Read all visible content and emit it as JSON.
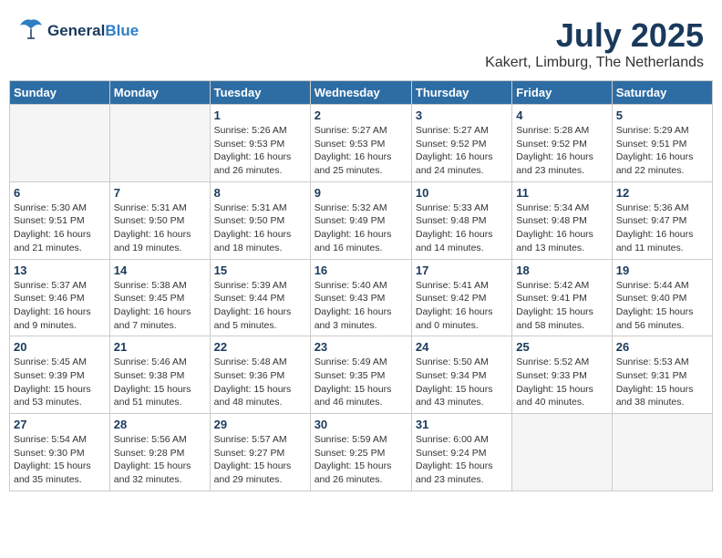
{
  "header": {
    "logo_general": "General",
    "logo_blue": "Blue",
    "month_title": "July 2025",
    "location": "Kakert, Limburg, The Netherlands"
  },
  "weekdays": [
    "Sunday",
    "Monday",
    "Tuesday",
    "Wednesday",
    "Thursday",
    "Friday",
    "Saturday"
  ],
  "weeks": [
    [
      {
        "day": "",
        "sunrise": "",
        "sunset": "",
        "daylight": ""
      },
      {
        "day": "",
        "sunrise": "",
        "sunset": "",
        "daylight": ""
      },
      {
        "day": "1",
        "sunrise": "Sunrise: 5:26 AM",
        "sunset": "Sunset: 9:53 PM",
        "daylight": "Daylight: 16 hours and 26 minutes."
      },
      {
        "day": "2",
        "sunrise": "Sunrise: 5:27 AM",
        "sunset": "Sunset: 9:53 PM",
        "daylight": "Daylight: 16 hours and 25 minutes."
      },
      {
        "day": "3",
        "sunrise": "Sunrise: 5:27 AM",
        "sunset": "Sunset: 9:52 PM",
        "daylight": "Daylight: 16 hours and 24 minutes."
      },
      {
        "day": "4",
        "sunrise": "Sunrise: 5:28 AM",
        "sunset": "Sunset: 9:52 PM",
        "daylight": "Daylight: 16 hours and 23 minutes."
      },
      {
        "day": "5",
        "sunrise": "Sunrise: 5:29 AM",
        "sunset": "Sunset: 9:51 PM",
        "daylight": "Daylight: 16 hours and 22 minutes."
      }
    ],
    [
      {
        "day": "6",
        "sunrise": "Sunrise: 5:30 AM",
        "sunset": "Sunset: 9:51 PM",
        "daylight": "Daylight: 16 hours and 21 minutes."
      },
      {
        "day": "7",
        "sunrise": "Sunrise: 5:31 AM",
        "sunset": "Sunset: 9:50 PM",
        "daylight": "Daylight: 16 hours and 19 minutes."
      },
      {
        "day": "8",
        "sunrise": "Sunrise: 5:31 AM",
        "sunset": "Sunset: 9:50 PM",
        "daylight": "Daylight: 16 hours and 18 minutes."
      },
      {
        "day": "9",
        "sunrise": "Sunrise: 5:32 AM",
        "sunset": "Sunset: 9:49 PM",
        "daylight": "Daylight: 16 hours and 16 minutes."
      },
      {
        "day": "10",
        "sunrise": "Sunrise: 5:33 AM",
        "sunset": "Sunset: 9:48 PM",
        "daylight": "Daylight: 16 hours and 14 minutes."
      },
      {
        "day": "11",
        "sunrise": "Sunrise: 5:34 AM",
        "sunset": "Sunset: 9:48 PM",
        "daylight": "Daylight: 16 hours and 13 minutes."
      },
      {
        "day": "12",
        "sunrise": "Sunrise: 5:36 AM",
        "sunset": "Sunset: 9:47 PM",
        "daylight": "Daylight: 16 hours and 11 minutes."
      }
    ],
    [
      {
        "day": "13",
        "sunrise": "Sunrise: 5:37 AM",
        "sunset": "Sunset: 9:46 PM",
        "daylight": "Daylight: 16 hours and 9 minutes."
      },
      {
        "day": "14",
        "sunrise": "Sunrise: 5:38 AM",
        "sunset": "Sunset: 9:45 PM",
        "daylight": "Daylight: 16 hours and 7 minutes."
      },
      {
        "day": "15",
        "sunrise": "Sunrise: 5:39 AM",
        "sunset": "Sunset: 9:44 PM",
        "daylight": "Daylight: 16 hours and 5 minutes."
      },
      {
        "day": "16",
        "sunrise": "Sunrise: 5:40 AM",
        "sunset": "Sunset: 9:43 PM",
        "daylight": "Daylight: 16 hours and 3 minutes."
      },
      {
        "day": "17",
        "sunrise": "Sunrise: 5:41 AM",
        "sunset": "Sunset: 9:42 PM",
        "daylight": "Daylight: 16 hours and 0 minutes."
      },
      {
        "day": "18",
        "sunrise": "Sunrise: 5:42 AM",
        "sunset": "Sunset: 9:41 PM",
        "daylight": "Daylight: 15 hours and 58 minutes."
      },
      {
        "day": "19",
        "sunrise": "Sunrise: 5:44 AM",
        "sunset": "Sunset: 9:40 PM",
        "daylight": "Daylight: 15 hours and 56 minutes."
      }
    ],
    [
      {
        "day": "20",
        "sunrise": "Sunrise: 5:45 AM",
        "sunset": "Sunset: 9:39 PM",
        "daylight": "Daylight: 15 hours and 53 minutes."
      },
      {
        "day": "21",
        "sunrise": "Sunrise: 5:46 AM",
        "sunset": "Sunset: 9:38 PM",
        "daylight": "Daylight: 15 hours and 51 minutes."
      },
      {
        "day": "22",
        "sunrise": "Sunrise: 5:48 AM",
        "sunset": "Sunset: 9:36 PM",
        "daylight": "Daylight: 15 hours and 48 minutes."
      },
      {
        "day": "23",
        "sunrise": "Sunrise: 5:49 AM",
        "sunset": "Sunset: 9:35 PM",
        "daylight": "Daylight: 15 hours and 46 minutes."
      },
      {
        "day": "24",
        "sunrise": "Sunrise: 5:50 AM",
        "sunset": "Sunset: 9:34 PM",
        "daylight": "Daylight: 15 hours and 43 minutes."
      },
      {
        "day": "25",
        "sunrise": "Sunrise: 5:52 AM",
        "sunset": "Sunset: 9:33 PM",
        "daylight": "Daylight: 15 hours and 40 minutes."
      },
      {
        "day": "26",
        "sunrise": "Sunrise: 5:53 AM",
        "sunset": "Sunset: 9:31 PM",
        "daylight": "Daylight: 15 hours and 38 minutes."
      }
    ],
    [
      {
        "day": "27",
        "sunrise": "Sunrise: 5:54 AM",
        "sunset": "Sunset: 9:30 PM",
        "daylight": "Daylight: 15 hours and 35 minutes."
      },
      {
        "day": "28",
        "sunrise": "Sunrise: 5:56 AM",
        "sunset": "Sunset: 9:28 PM",
        "daylight": "Daylight: 15 hours and 32 minutes."
      },
      {
        "day": "29",
        "sunrise": "Sunrise: 5:57 AM",
        "sunset": "Sunset: 9:27 PM",
        "daylight": "Daylight: 15 hours and 29 minutes."
      },
      {
        "day": "30",
        "sunrise": "Sunrise: 5:59 AM",
        "sunset": "Sunset: 9:25 PM",
        "daylight": "Daylight: 15 hours and 26 minutes."
      },
      {
        "day": "31",
        "sunrise": "Sunrise: 6:00 AM",
        "sunset": "Sunset: 9:24 PM",
        "daylight": "Daylight: 15 hours and 23 minutes."
      },
      {
        "day": "",
        "sunrise": "",
        "sunset": "",
        "daylight": ""
      },
      {
        "day": "",
        "sunrise": "",
        "sunset": "",
        "daylight": ""
      }
    ]
  ]
}
